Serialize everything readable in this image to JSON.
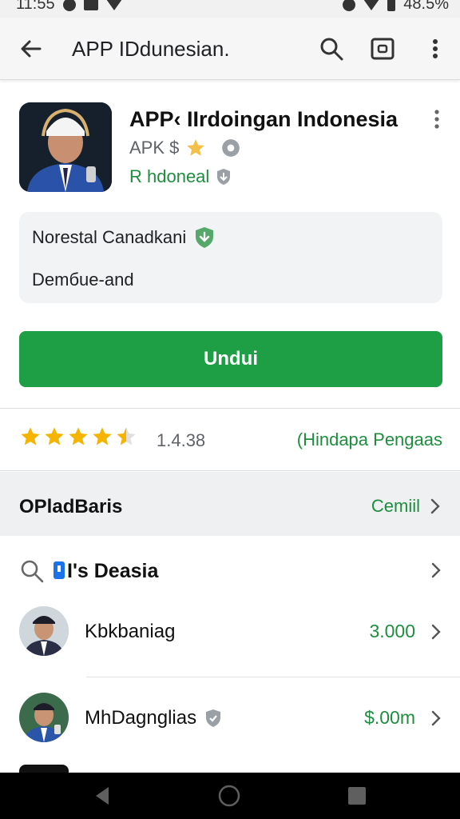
{
  "status_bar": {
    "time": "11:55",
    "battery": "48.5%"
  },
  "app_bar": {
    "title": "APP IDdunesian."
  },
  "app": {
    "name": "APP‹ IIrdoingan Indonesia",
    "sub_label": "APK $",
    "developer": "R hdoneal"
  },
  "info_card": {
    "line1": "Norestal Canadkani",
    "line2": "Demбue-and"
  },
  "install": {
    "label": "Undui"
  },
  "rating": {
    "stars": 4.5,
    "max": 5,
    "value_text": "1.4.38",
    "link": "(Hindapa Pengaas"
  },
  "section": {
    "title": "OPladBaris",
    "link": "Cemiil"
  },
  "list": {
    "search_label": "I's Deasia",
    "items": [
      {
        "name": "Kbkbaniag",
        "price": "3.000"
      },
      {
        "name": "MhDagnglias",
        "price": "$.00m"
      }
    ]
  },
  "colors": {
    "accent": "#1e9e45",
    "link": "#1e8e3e",
    "star": "#f4b400"
  },
  "icons": [
    "back-arrow-icon",
    "search-icon",
    "screenshot-icon",
    "more-vert-icon",
    "star-icon",
    "shield-icon",
    "verified-icon",
    "chevron-right-icon",
    "nav-back-icon",
    "nav-home-icon",
    "nav-recents-icon"
  ]
}
